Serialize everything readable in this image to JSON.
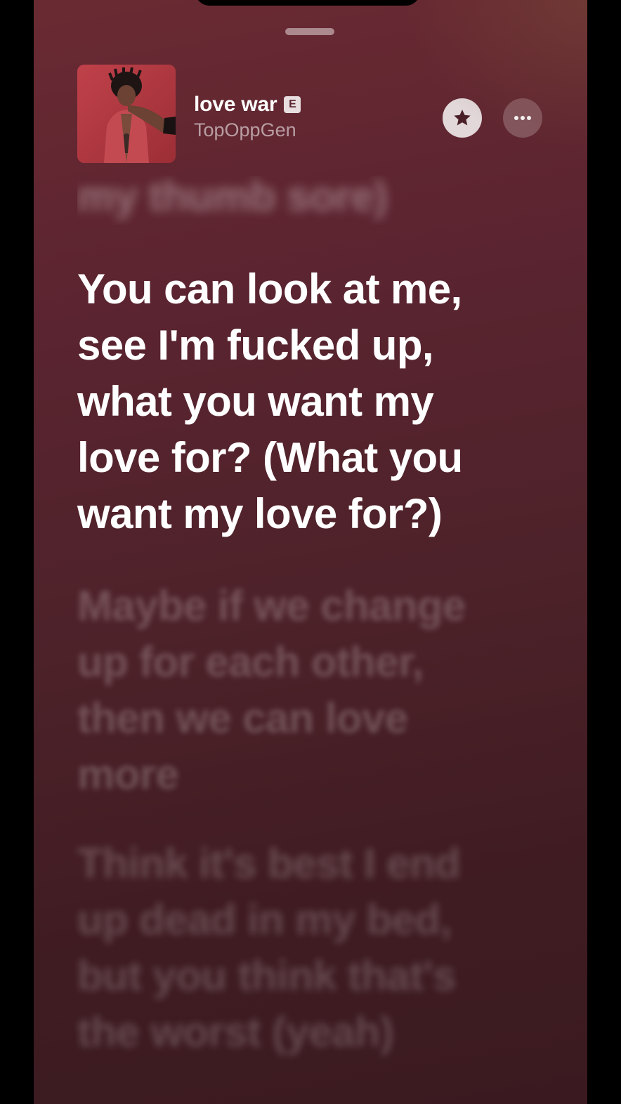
{
  "track": {
    "title": "love war",
    "explicit_badge": "E",
    "artist": "TopOppGen"
  },
  "icons": {
    "favorite": "star-icon",
    "more": "ellipsis-icon"
  },
  "lyrics": {
    "previous": "my thumb sore)",
    "current": "You can look at me, see I'm fucked up, what you want my love for? (What you want my love for?)",
    "next": [
      "Maybe if we change up for each other, then we can love more",
      "Think it's best I end up dead in my bed, but you think that's the worst (yeah)"
    ]
  },
  "colors": {
    "background_top": "#6a2a32",
    "background_bottom": "#3a1a20",
    "artwork_red": "#b6383f"
  }
}
